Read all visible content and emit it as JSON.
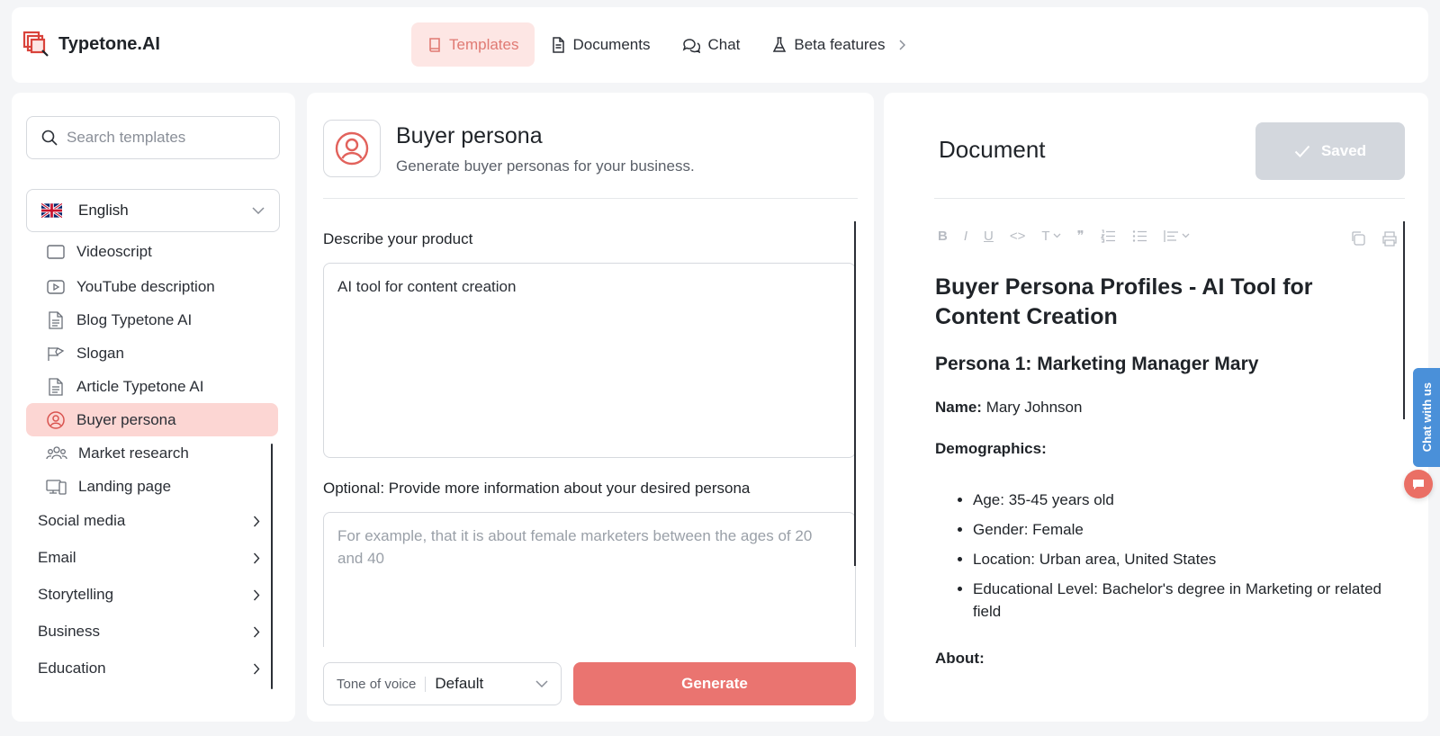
{
  "app": {
    "name": "Typetone.AI"
  },
  "nav": {
    "items": [
      {
        "label": "Templates"
      },
      {
        "label": "Documents"
      },
      {
        "label": "Chat"
      },
      {
        "label": "Beta features"
      }
    ]
  },
  "sidebar": {
    "search_placeholder": "Search templates",
    "language": "English",
    "templates": [
      {
        "label": "Videoscript",
        "icon": "video-icon"
      },
      {
        "label": "YouTube description",
        "icon": "youtube-icon"
      },
      {
        "label": "Blog Typetone AI",
        "icon": "document-icon"
      },
      {
        "label": "Slogan",
        "icon": "megaphone-icon"
      },
      {
        "label": "Article Typetone AI",
        "icon": "document-icon"
      },
      {
        "label": "Buyer persona",
        "icon": "user-circle-icon"
      },
      {
        "label": "Market research",
        "icon": "users-icon"
      },
      {
        "label": "Landing page",
        "icon": "devices-icon"
      }
    ],
    "categories": [
      {
        "label": "Social media"
      },
      {
        "label": "Email"
      },
      {
        "label": "Storytelling"
      },
      {
        "label": "Business"
      },
      {
        "label": "Education"
      }
    ]
  },
  "form": {
    "title": "Buyer persona",
    "subtitle": "Generate buyer personas for your business.",
    "product_label": "Describe your product",
    "product_value": "AI tool for content creation",
    "persona_label": "Optional: Provide more information about your desired persona",
    "persona_placeholder": "For example, that it is about female marketers between the ages of 20 and 40",
    "tone_label": "Tone of voice",
    "tone_value": "Default",
    "generate_label": "Generate"
  },
  "document": {
    "title": "Document",
    "saved_label": "Saved",
    "toolbar": {
      "bold": "B",
      "italic": "I",
      "underline": "U",
      "code": "<>",
      "text": "T",
      "quote": "❞"
    },
    "h1": "Buyer Persona Profiles - AI Tool for Content Creation",
    "h2": "Persona 1: Marketing Manager Mary",
    "name_label": "Name:",
    "name_value": " Mary Johnson",
    "demographics_label": "Demographics:",
    "demographics": [
      "Age: 35-45 years old",
      "Gender: Female",
      "Location: Urban area, United States",
      "Educational Level: Bachelor's degree in Marketing or related field"
    ],
    "about_label": "About:"
  },
  "chat_widget": {
    "label": "Chat with us"
  },
  "colors": {
    "accent": "#ea7470",
    "accent_light": "#fde6e4",
    "chat_tab": "#4a90d9"
  }
}
